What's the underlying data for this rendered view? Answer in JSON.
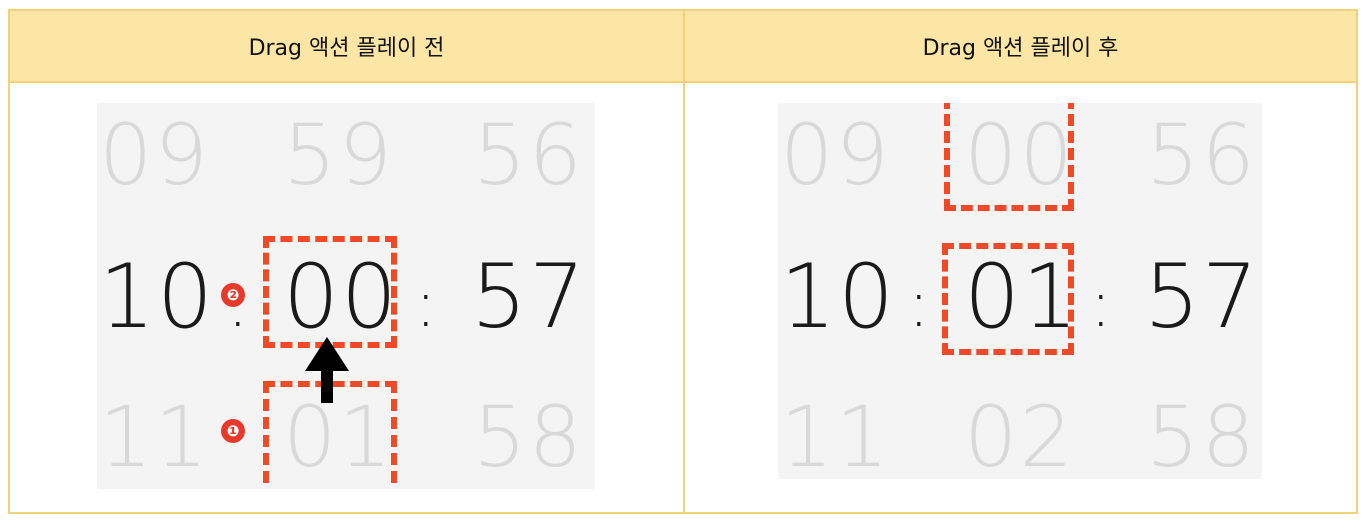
{
  "headers": {
    "before": "Drag 액션 플레이 전",
    "after": "Drag 액션 플레이 후"
  },
  "before": {
    "top": [
      "09",
      "59",
      "56"
    ],
    "selected": [
      "10",
      "00",
      "57"
    ],
    "bottom": [
      "11",
      "01",
      "58"
    ],
    "separator": ":",
    "badges": [
      "❷",
      "❶"
    ],
    "arrow_icon": "up-arrow-icon"
  },
  "after": {
    "top": [
      "09",
      "00",
      "56"
    ],
    "selected": [
      "10",
      "01",
      "57"
    ],
    "bottom": [
      "11",
      "02",
      "58"
    ],
    "separator": ":"
  },
  "colors": {
    "header_bg": "#fbe6a6",
    "border": "#f1d27a",
    "highlight_dash": "#ef4a27",
    "badge": "#e8392a"
  }
}
